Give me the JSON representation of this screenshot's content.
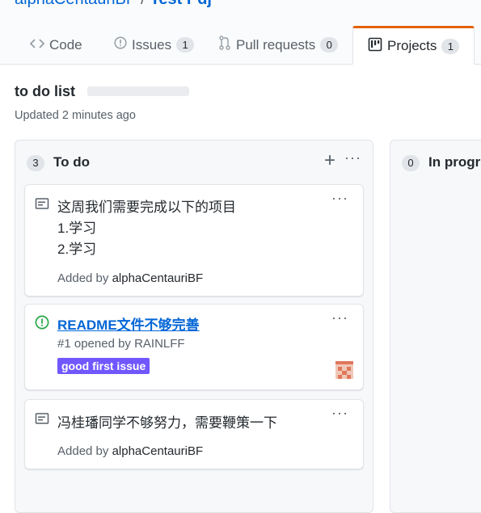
{
  "repo": {
    "owner": "alphaCentauriBF",
    "separator": "/",
    "name": "Test Pdj"
  },
  "tabs": [
    {
      "label": "Code",
      "icon": "code-icon",
      "count": null
    },
    {
      "label": "Issues",
      "icon": "issue-opened-icon",
      "count": "1"
    },
    {
      "label": "Pull requests",
      "icon": "git-pull-request-icon",
      "count": "0"
    },
    {
      "label": "Projects",
      "icon": "project-icon",
      "count": "1",
      "selected": true
    }
  ],
  "project": {
    "title": "to do list",
    "updated": "Updated 2 minutes ago"
  },
  "columns": [
    {
      "count": "3",
      "name": "To do",
      "add_icon": "plus-icon",
      "menu_icon": "kebab-horizontal-icon",
      "cards": [
        {
          "type": "note",
          "lines": [
            "这周我们需要完成以下的项目",
            "1.学习",
            "2.学习"
          ],
          "added_prefix": "Added by",
          "author": "alphaCentauriBF"
        },
        {
          "type": "issue",
          "title": "README文件不够完善",
          "meta": "#1 opened by RAINLFF",
          "label": "good first issue",
          "label_color": "#7057ff"
        },
        {
          "type": "note",
          "lines": [
            "冯桂璠同学不够努力，需要鞭策一下"
          ],
          "added_prefix": "Added by",
          "author": "alphaCentauriBF"
        }
      ]
    },
    {
      "count": "0",
      "name": "In progress"
    }
  ],
  "colors": {
    "accent_tab": "#e36209",
    "link": "#0366d6",
    "open_issue": "#28a745"
  }
}
